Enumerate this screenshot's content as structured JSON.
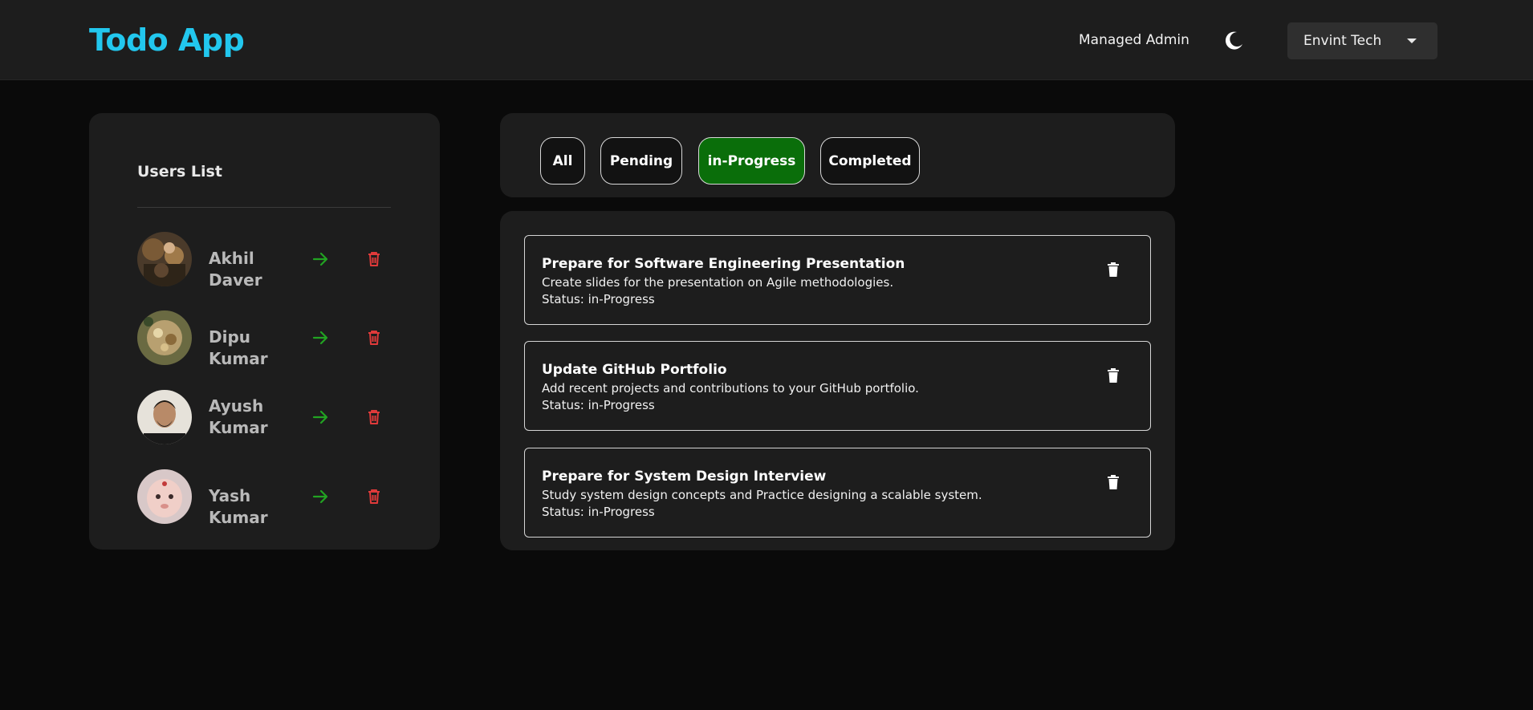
{
  "header": {
    "logo": "Todo App",
    "user_label": "Managed Admin",
    "theme_icon": "moon-icon",
    "org_select": {
      "selected": "Envint Tech",
      "icon": "caret-down-icon"
    }
  },
  "users": {
    "title": "Users List",
    "items": [
      {
        "name": "Akhil Daver",
        "avatar": "avatar-photo",
        "go_icon": "arrow-right-icon",
        "delete_icon": "trash-icon"
      },
      {
        "name": "Dipu Kumar",
        "avatar": "avatar-photo",
        "go_icon": "arrow-right-icon",
        "delete_icon": "trash-icon"
      },
      {
        "name": "Ayush Kumar",
        "avatar": "avatar-photo",
        "go_icon": "arrow-right-icon",
        "delete_icon": "trash-icon"
      },
      {
        "name": "Yash Kumar",
        "avatar": "avatar-photo",
        "go_icon": "arrow-right-icon",
        "delete_icon": "trash-icon"
      }
    ]
  },
  "filters": {
    "tabs": [
      {
        "label": "All"
      },
      {
        "label": "Pending"
      },
      {
        "label": "in-Progress"
      },
      {
        "label": "Completed"
      }
    ],
    "active": "in-Progress"
  },
  "tasks": [
    {
      "title": "Prepare for Software Engineering Presentation",
      "description": "Create slides for the presentation on Agile methodologies.",
      "status": "Status: in-Progress"
    },
    {
      "title": "Update GitHub Portfolio",
      "description": "Add recent projects and contributions to your GitHub portfolio.",
      "status": "Status: in-Progress"
    },
    {
      "title": "Prepare for System Design Interview",
      "description": "Study system design concepts and Practice designing a scalable system.",
      "status": "Status: in-Progress"
    }
  ],
  "colors": {
    "logo": "#22c7ee",
    "active_filter": "#0a6e0a",
    "go_arrow": "#22a322",
    "delete_user": "#e03a3a",
    "panel": "#1d1d1d",
    "background": "#0a0a0a"
  }
}
